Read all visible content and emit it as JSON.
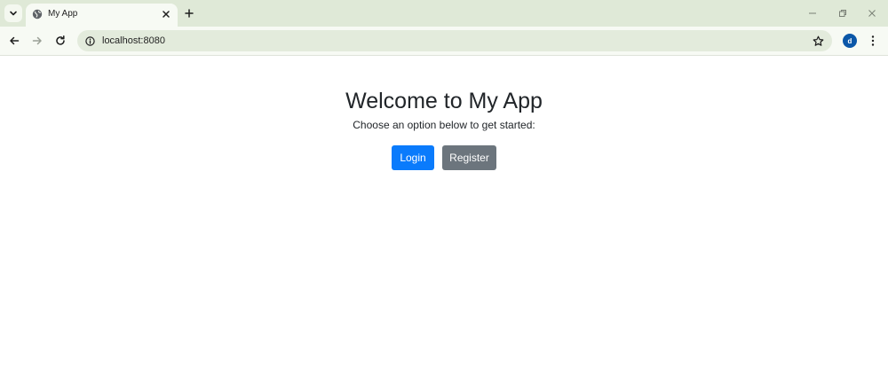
{
  "browser": {
    "tab": {
      "title": "My App"
    },
    "address_bar": {
      "url": "localhost:8080"
    },
    "profile": {
      "initial": "d"
    },
    "icons": {
      "tab_search": "chevron-down-icon",
      "favicon": "globe-icon",
      "tab_close": "close-icon",
      "new_tab": "plus-icon",
      "minimize": "minimize-icon",
      "restore": "restore-icon",
      "close_window": "close-icon",
      "back": "arrow-left-icon",
      "forward": "arrow-right-icon",
      "reload": "reload-icon",
      "site_info": "info-icon",
      "bookmark": "star-icon",
      "menu": "kebab-menu-icon"
    },
    "colors": {
      "tabstrip": "#dfe9d7",
      "toolbar": "#f7faf4",
      "omnibox": "#e3ebdc",
      "profile": "#0b57a8"
    }
  },
  "page": {
    "heading": "Welcome to My App",
    "subtext": "Choose an option below to get started:",
    "buttons": {
      "login": "Login",
      "register": "Register"
    },
    "colors": {
      "login_button": "#0a7bfc",
      "register_button": "#6c757d",
      "text": "#212529"
    }
  }
}
